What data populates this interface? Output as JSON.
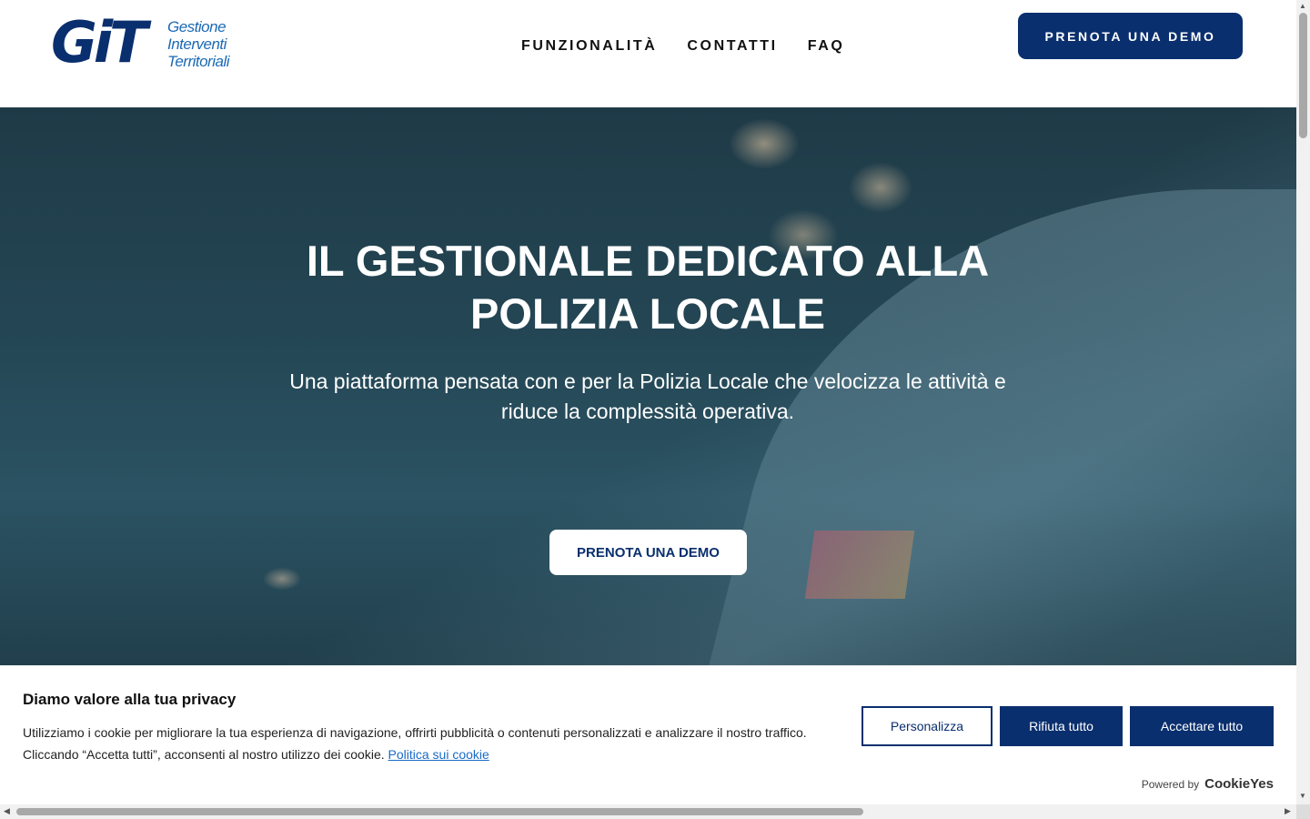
{
  "brand": {
    "logo_mark": "GiT",
    "logo_line1": "Gestione",
    "logo_line2": "Interventi",
    "logo_line3": "Territoriali"
  },
  "nav": {
    "items": [
      "FUNZIONALITÀ",
      "CONTATTI",
      "FAQ"
    ],
    "cta": "PRENOTA UNA DEMO"
  },
  "hero": {
    "title_line1": "IL GESTIONALE DEDICATO ALLA",
    "title_line2": "POLIZIA LOCALE",
    "subtitle_line1": "Una piattaforma pensata con e per la Polizia Locale che velocizza le attività e",
    "subtitle_line2": "riduce la complessità operativa.",
    "cta": "PRENOTA UNA DEMO"
  },
  "cookie_banner": {
    "title": "Diamo valore alla tua privacy",
    "text": "Utilizziamo i cookie per migliorare la tua esperienza di navigazione, offrirti pubblicità o contenuti personalizzati e analizzare il nostro traffico. Cliccando “Accetta tutti”, acconsenti al nostro utilizzo dei cookie.",
    "link": "Politica sui cookie",
    "customize": "Personalizza",
    "reject": "Rifiuta tutto",
    "accept": "Accettare tutto",
    "powered_by": "Powered by",
    "powered_brand": "CookieYes"
  },
  "colors": {
    "primary": "#0a2f6e",
    "accent": "#1c6ab5",
    "hero_overlay": "#244654"
  }
}
